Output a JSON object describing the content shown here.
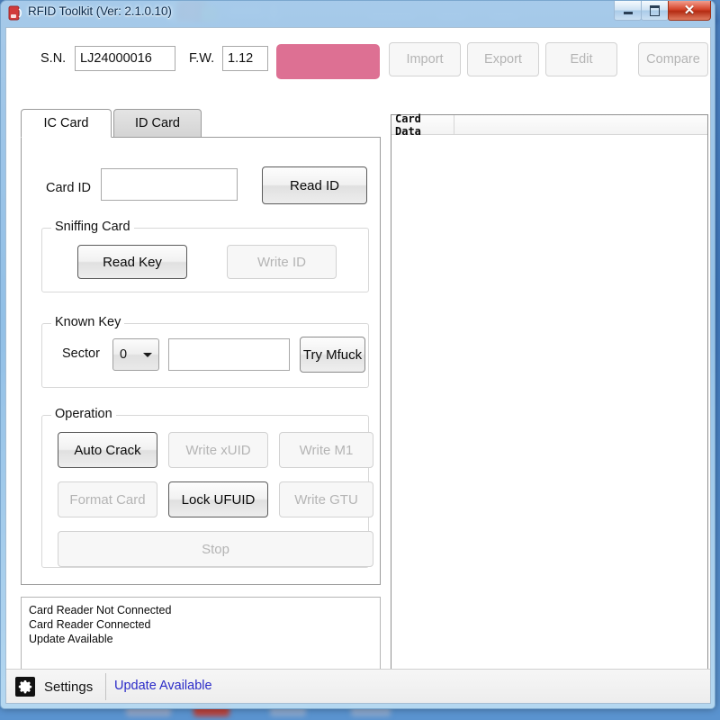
{
  "window": {
    "title": "RFID Toolkit (Ver: 2.1.0.10)",
    "icon": "rfid-card-icon",
    "minimize_label": "",
    "maximize_label": "",
    "close_label": "✕"
  },
  "header": {
    "sn_label": "S.N.",
    "sn_value": "LJ24000016",
    "fw_label": "F.W.",
    "fw_value": "1.12",
    "status_indicator_color": "#DD7093"
  },
  "toolbar": {
    "buttons": [
      {
        "id": "import",
        "label": "Import",
        "enabled": false
      },
      {
        "id": "export",
        "label": "Export",
        "enabled": false
      },
      {
        "id": "edit",
        "label": "Edit",
        "enabled": false
      },
      {
        "id": "compare",
        "label": "Compare",
        "enabled": false
      }
    ]
  },
  "tabs": {
    "items": [
      {
        "id": "ic-card",
        "label": "IC Card",
        "active": true
      },
      {
        "id": "id-card",
        "label": "ID Card",
        "active": false
      }
    ]
  },
  "ic_card_panel": {
    "card_id_label": "Card ID",
    "card_id_value": "",
    "read_id_button": "Read ID",
    "sniffing": {
      "title": "Sniffing Card",
      "read_key_button": "Read Key",
      "write_id_button": "Write ID"
    },
    "known_key": {
      "title": "Known Key",
      "sector_label": "Sector",
      "sector_value": "0",
      "key_value": "",
      "try_button": "Try Mfuck"
    },
    "operation": {
      "title": "Operation",
      "auto_crack_button": "Auto Crack",
      "write_xuid_button": "Write xUID",
      "write_m1_button": "Write M1",
      "format_card_button": "Format Card",
      "lock_ufuid_button": "Lock UFUID",
      "write_gtu_button": "Write GTU",
      "stop_button": "Stop"
    }
  },
  "log": {
    "lines": [
      "Card Reader Not Connected",
      "Card Reader Connected",
      "Update Available"
    ]
  },
  "card_data": {
    "column_header": "Card Data",
    "rows": []
  },
  "statusbar": {
    "settings_label": "Settings",
    "settings_icon": "gear-icon",
    "update_link": "Update Available",
    "update_link_color": "#2B2BC8"
  }
}
